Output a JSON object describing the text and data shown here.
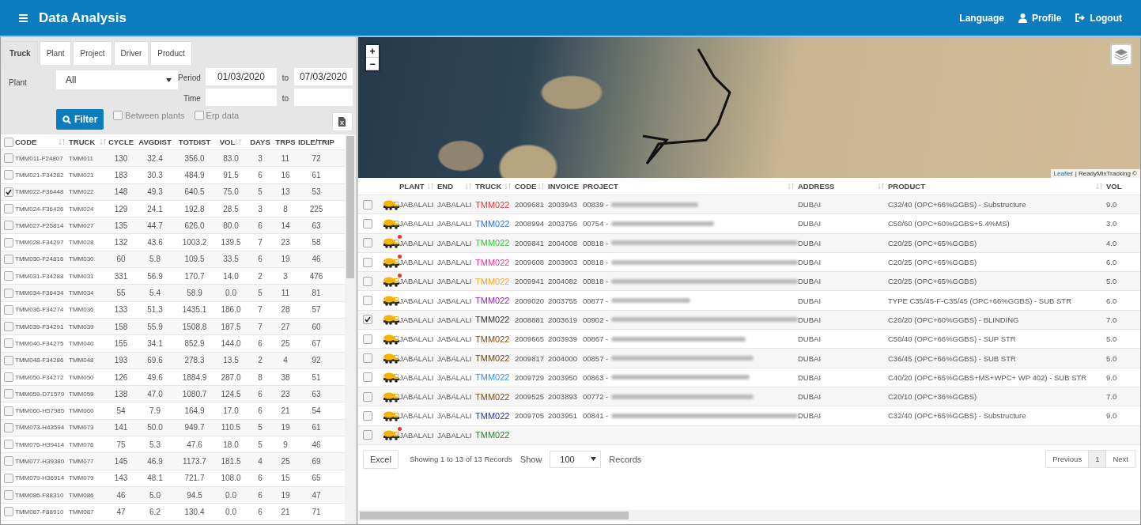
{
  "header": {
    "title": "Data Analysis",
    "nav": [
      {
        "label": "Language"
      },
      {
        "label": "Profile"
      },
      {
        "label": "Logout"
      }
    ]
  },
  "tabs": [
    {
      "label": "Truck",
      "selected": true
    },
    {
      "label": "Plant",
      "selected": false
    },
    {
      "label": "Project",
      "selected": false
    },
    {
      "label": "Driver",
      "selected": false
    },
    {
      "label": "Product",
      "selected": false
    }
  ],
  "filter": {
    "plant_label": "Plant",
    "plant_value": "All",
    "period_label": "Period",
    "period_from": "01/03/2020",
    "period_to_label": "to",
    "period_to": "07/03/2020",
    "time_label": "Time",
    "time_to_label": "to",
    "filter_button": "Filter",
    "options": [
      {
        "label": "Between plants",
        "checked": false
      },
      {
        "label": "Erp data",
        "checked": false
      }
    ]
  },
  "left_table": {
    "all_checked": false,
    "columns": [
      "CODE",
      "TRUCK",
      "CYCLE",
      "AVGDIST",
      "TOTDIST",
      "VOL",
      "DAYS",
      "TRPS",
      "IDLE/TRIP"
    ],
    "rows": [
      {
        "checked": false,
        "cells": [
          "TMM011-F24807",
          "TMM011",
          "130",
          "32.4",
          "356.0",
          "83.0",
          "3",
          "11",
          "72"
        ]
      },
      {
        "checked": false,
        "cells": [
          "TMM021-F34282",
          "TMM021",
          "183",
          "30.3",
          "484.9",
          "91.5",
          "6",
          "16",
          "61"
        ]
      },
      {
        "checked": true,
        "cells": [
          "TMM022-F36448",
          "TMM022",
          "148",
          "49.3",
          "640.5",
          "75.0",
          "5",
          "13",
          "53"
        ]
      },
      {
        "checked": false,
        "cells": [
          "TMM024-F36426",
          "TMM024",
          "129",
          "24.1",
          "192.8",
          "28.5",
          "3",
          "8",
          "225"
        ]
      },
      {
        "checked": false,
        "cells": [
          "TMM027-F25814",
          "TMM027",
          "135",
          "44.7",
          "626.0",
          "80.0",
          "6",
          "14",
          "63"
        ]
      },
      {
        "checked": false,
        "cells": [
          "TMM028-F34297",
          "TMM028",
          "132",
          "43.6",
          "1003.2",
          "139.5",
          "7",
          "23",
          "58"
        ]
      },
      {
        "checked": false,
        "cells": [
          "TMM030-F24816",
          "TMM030",
          "60",
          "5.8",
          "109.5",
          "33.5",
          "6",
          "19",
          "46"
        ]
      },
      {
        "checked": false,
        "cells": [
          "TMM031-F34288",
          "TMM031",
          "331",
          "56.9",
          "170.7",
          "14.0",
          "2",
          "3",
          "476"
        ]
      },
      {
        "checked": false,
        "cells": [
          "TMM034-F36434",
          "TMM034",
          "55",
          "5.4",
          "58.9",
          "0.0",
          "5",
          "11",
          "81"
        ]
      },
      {
        "checked": false,
        "cells": [
          "TMM036-F34274",
          "TMM036",
          "133",
          "51.3",
          "1435.1",
          "186.0",
          "7",
          "28",
          "57"
        ]
      },
      {
        "checked": false,
        "cells": [
          "TMM039-F34291",
          "TMM039",
          "158",
          "55.9",
          "1508.8",
          "187.5",
          "7",
          "27",
          "60"
        ]
      },
      {
        "checked": false,
        "cells": [
          "TMM040-F34275",
          "TMM040",
          "155",
          "34.1",
          "852.9",
          "144.0",
          "6",
          "25",
          "67"
        ]
      },
      {
        "checked": false,
        "cells": [
          "TMM048-F34286",
          "TMM048",
          "193",
          "69.6",
          "278.3",
          "13.5",
          "2",
          "4",
          "92"
        ]
      },
      {
        "checked": false,
        "cells": [
          "TMM050-F34272",
          "TMM050",
          "126",
          "49.6",
          "1884.9",
          "287.0",
          "8",
          "38",
          "51"
        ]
      },
      {
        "checked": false,
        "cells": [
          "TMM059-D71579",
          "TMM059",
          "138",
          "47.0",
          "1080.7",
          "124.5",
          "6",
          "23",
          "63"
        ]
      },
      {
        "checked": false,
        "cells": [
          "TMM060-H57985",
          "TMM060",
          "54",
          "7.9",
          "164.9",
          "17.0",
          "6",
          "21",
          "54"
        ]
      },
      {
        "checked": false,
        "cells": [
          "TMM073-H43594",
          "TMM073",
          "141",
          "50.0",
          "949.7",
          "110.5",
          "5",
          "19",
          "61"
        ]
      },
      {
        "checked": false,
        "cells": [
          "TMM076-H39414",
          "TMM076",
          "75",
          "5.3",
          "47.6",
          "18.0",
          "5",
          "9",
          "46"
        ]
      },
      {
        "checked": false,
        "cells": [
          "TMM077-H39380",
          "TMM077",
          "145",
          "46.9",
          "1173.7",
          "181.5",
          "4",
          "25",
          "69"
        ]
      },
      {
        "checked": false,
        "cells": [
          "TMM079-H36914",
          "TMM079",
          "143",
          "48.1",
          "721.7",
          "108.0",
          "6",
          "15",
          "65"
        ]
      },
      {
        "checked": false,
        "cells": [
          "TMM086-F88310",
          "TMM086",
          "46",
          "5.0",
          "94.5",
          "0.0",
          "6",
          "19",
          "47"
        ]
      },
      {
        "checked": false,
        "cells": [
          "TMM087-F88910",
          "TMM087",
          "47",
          "6.2",
          "130.4",
          "0.0",
          "6",
          "21",
          "71"
        ]
      }
    ]
  },
  "map": {
    "zoom_in": "+",
    "zoom_out": "−",
    "attribution_link": "Leaflet",
    "attribution": "| ReadyMixTracking ©"
  },
  "right_table": {
    "columns": [
      "PLANT",
      "END",
      "TRUCK",
      "CODE",
      "INVOICE",
      "PROJECT",
      "ADDRESS",
      "PRODUCT",
      "VOL"
    ],
    "rows": [
      {
        "checked": false,
        "alert": false,
        "plant": "JABALALI",
        "end": "JABALALI",
        "truck": "TMM022",
        "color": "#e53935",
        "code": "2009681",
        "invoice": "2003943",
        "project": "00839 -",
        "address": "DUBAI",
        "product": "C32/40 (OPC+66%GGBS) - Substructure",
        "vol": "9.0"
      },
      {
        "checked": false,
        "alert": false,
        "plant": "JABALALI",
        "end": "JABALALI",
        "truck": "TMM022",
        "color": "#2f6fde",
        "code": "2008994",
        "invoice": "2003756",
        "project": "00754 -",
        "address": "DUBAI",
        "product": "C50/60 (OPC+60%GGBS+5.4%MS)",
        "vol": "3.0"
      },
      {
        "checked": false,
        "alert": true,
        "plant": "JABALALI",
        "end": "JABALALI",
        "truck": "TMM022",
        "color": "#33cc33",
        "code": "2009841",
        "invoice": "2004008",
        "project": "00818 -",
        "address": "DUBAI",
        "product": "C20/25 (OPC+65%GGBS)",
        "vol": "4.0"
      },
      {
        "checked": false,
        "alert": true,
        "plant": "JABALALI",
        "end": "JABALALI",
        "truck": "TMM022",
        "color": "#f0309a",
        "code": "2009608",
        "invoice": "2003903",
        "project": "00818 -",
        "address": "DUBAI",
        "product": "C20/25 (OPC+65%GGBS)",
        "vol": "6.0"
      },
      {
        "checked": false,
        "alert": true,
        "plant": "JABALALI",
        "end": "JABALALI",
        "truck": "TMM022",
        "color": "#f5a623",
        "code": "2009941",
        "invoice": "2004082",
        "project": "00818 -",
        "address": "DUBAI",
        "product": "C20/25 (OPC+65%GGBS)",
        "vol": "5.0"
      },
      {
        "checked": false,
        "alert": false,
        "plant": "JABALALI",
        "end": "JABALALI",
        "truck": "TMM022",
        "color": "#8e24aa",
        "code": "2009020",
        "invoice": "2003755",
        "project": "00877 -",
        "address": "DUBAI",
        "product": "TYPE C35/45-F-C35/45 (OPC+66%GGBS) - SUB STR",
        "vol": "6.0"
      },
      {
        "checked": true,
        "alert": false,
        "plant": "JABALALI",
        "end": "JABALALI",
        "truck": "TMM022",
        "color": "#333333",
        "code": "2008881",
        "invoice": "2003619",
        "project": "00902 -",
        "address": "DUBAI",
        "product": "C20/20 (OPC+60%GGBS) - BLINDING",
        "vol": "7.0"
      },
      {
        "checked": false,
        "alert": false,
        "plant": "JABALALI",
        "end": "JABALALI",
        "truck": "TMM022",
        "color": "#7a4e12",
        "code": "2009665",
        "invoice": "2003939",
        "project": "00867 -",
        "address": "DUBAI",
        "product": "C50/40 (OPC+66%GGBS) - SUP STR",
        "vol": "5.0"
      },
      {
        "checked": false,
        "alert": false,
        "plant": "JABALALI",
        "end": "JABALALI",
        "truck": "TMM022",
        "color": "#6b4412",
        "code": "2009817",
        "invoice": "2004000",
        "project": "00857 -",
        "address": "DUBAI",
        "product": "C36/45 (OPC+66%GGBS) - SUB STR",
        "vol": "5.0"
      },
      {
        "checked": false,
        "alert": false,
        "plant": "JABALALI",
        "end": "JABALALI",
        "truck": "TMM022",
        "color": "#3a8fe8",
        "code": "2009729",
        "invoice": "2003950",
        "project": "00863 -",
        "address": "DUBAI",
        "product": "C40/20 (OPC+65%GGBS+MS+WPC+ WP 402) - SUB STR",
        "vol": "9.0"
      },
      {
        "checked": false,
        "alert": false,
        "plant": "JABALALI",
        "end": "JABALALI",
        "truck": "TMM022",
        "color": "#7a4e12",
        "code": "2009525",
        "invoice": "2003893",
        "project": "00772 -",
        "address": "DUBAI",
        "product": "C20/10 (OPC+36%GGBS)",
        "vol": "7.0"
      },
      {
        "checked": false,
        "alert": false,
        "plant": "JABALALI",
        "end": "JABALALI",
        "truck": "TMM022",
        "color": "#283593",
        "code": "2009705",
        "invoice": "2003951",
        "project": "00841 -",
        "address": "DUBAI",
        "product": "C32/40 (OPC+65%GGBS) - Substructure",
        "vol": "9.0"
      },
      {
        "checked": false,
        "alert": true,
        "plant": "JABALALI",
        "end": "JABALALI",
        "truck": "TMM022",
        "color": "#2e7d32"
      }
    ]
  },
  "footer": {
    "excel": "Excel",
    "info": "Showing 1 to 13 of 13 Records",
    "show": "Show",
    "page_size": "100",
    "records": "Records",
    "pages": [
      {
        "label": "Previous",
        "selected": false
      },
      {
        "label": "1",
        "selected": true
      },
      {
        "label": "Next",
        "selected": false
      }
    ]
  }
}
